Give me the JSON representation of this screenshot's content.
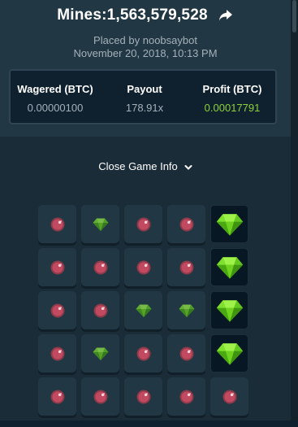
{
  "header": {
    "title": "Mines:1,563,579,528",
    "placed_by": "Placed by noobsaybot",
    "date": "November 20, 2018, 10:13 PM"
  },
  "stats": {
    "wagered_label": "Wagered (BTC)",
    "wagered_value": "0.00000100",
    "payout_label": "Payout",
    "payout_value": "178.91x",
    "profit_label": "Profit (BTC)",
    "profit_value": "0.00017791"
  },
  "toggle": {
    "label": "Close Game Info"
  },
  "colors": {
    "accent_green": "#8fd13b",
    "mine_red": "#e04b63",
    "gem_green": "#6fd21c"
  },
  "board": {
    "rows": [
      [
        "mine",
        "gem-faded",
        "mine",
        "mine",
        "gem-revealed"
      ],
      [
        "mine",
        "mine",
        "mine",
        "mine",
        "gem-revealed"
      ],
      [
        "mine",
        "mine",
        "gem-faded",
        "gem-faded",
        "gem-revealed"
      ],
      [
        "mine",
        "gem-faded",
        "mine",
        "mine",
        "gem-revealed"
      ],
      [
        "mine",
        "mine",
        "mine",
        "mine",
        "mine"
      ]
    ]
  }
}
